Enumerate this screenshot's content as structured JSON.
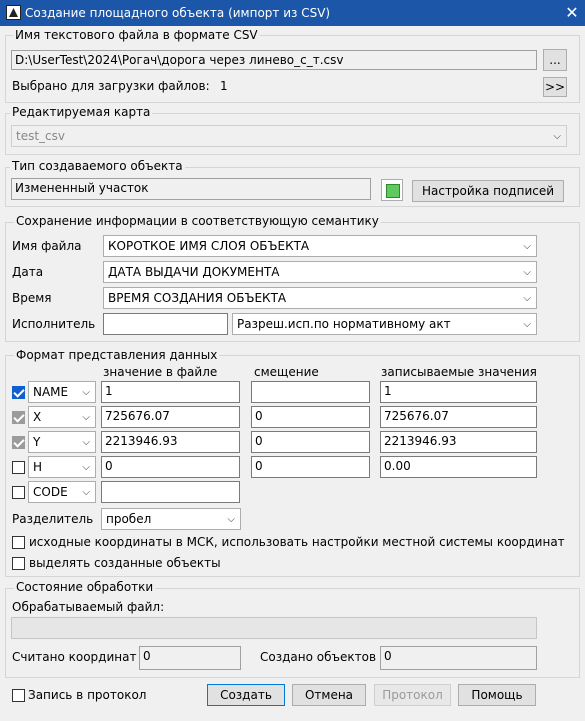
{
  "window": {
    "title": "Создание площадного объекта (импорт из CSV)",
    "close": "✕"
  },
  "file_group": {
    "title": "Имя текстового файла в формате CSV",
    "path": "D:\\UserTest\\2024\\Рогач\\дорога через линево_с_т.csv",
    "browse": "...",
    "selected_label": "Выбрано для загрузки файлов:",
    "selected_count": "1",
    "next": ">>"
  },
  "map_group": {
    "title": "Редактируемая карта",
    "value": "test_csv"
  },
  "type_group": {
    "title": "Тип создаваемого объекта",
    "value": "Измененный участок",
    "caption_settings": "Настройка подписей",
    "color": "#5ec95e"
  },
  "semantic_group": {
    "title": "Сохранение информации в соответствующую семантику",
    "rows": [
      {
        "label": "Имя файла",
        "value": "КОРОТКОЕ ИМЯ СЛОЯ ОБЪЕКТА"
      },
      {
        "label": "Дата",
        "value": "ДАТА ВЫДАЧИ ДОКУМЕНТА"
      },
      {
        "label": "Время",
        "value": "ВРЕМЯ СОЗДАНИЯ ОБЪЕКТА"
      }
    ],
    "executor_label": "Исполнитель",
    "executor_value": "",
    "executor_combo": "Разреш.исп.по нормативному акт"
  },
  "format_group": {
    "title": "Формат представления данных",
    "col_file": "значение в файле",
    "col_offset": "смещение",
    "col_written": "записываемые значения",
    "rows": [
      {
        "name": "NAME",
        "file": "1",
        "offset": "",
        "written": "1"
      },
      {
        "name": "X",
        "file": "725676.07",
        "offset": "0",
        "written": "725676.07"
      },
      {
        "name": "Y",
        "file": "2213946.93",
        "offset": "0",
        "written": "2213946.93"
      },
      {
        "name": "H",
        "file": "0",
        "offset": "0",
        "written": "0.00"
      },
      {
        "name": "CODE",
        "file": ""
      }
    ],
    "separator_label": "Разделитель",
    "separator_value": "пробел",
    "msk_label": "исходные координаты в МСК, использовать настройки местной системы координат",
    "select_label": "выделять созданные объекты"
  },
  "status_group": {
    "title": "Состояние обработки",
    "file_label": "Обрабатываемый файл:",
    "file_value": "",
    "coords_label": "Считано координат",
    "coords_value": "0",
    "objects_label": "Создано объектов",
    "objects_value": "0"
  },
  "footer": {
    "log_label": "Запись в протокол",
    "create": "Создать",
    "cancel": "Отмена",
    "protocol": "Протокол",
    "help": "Помощь"
  }
}
